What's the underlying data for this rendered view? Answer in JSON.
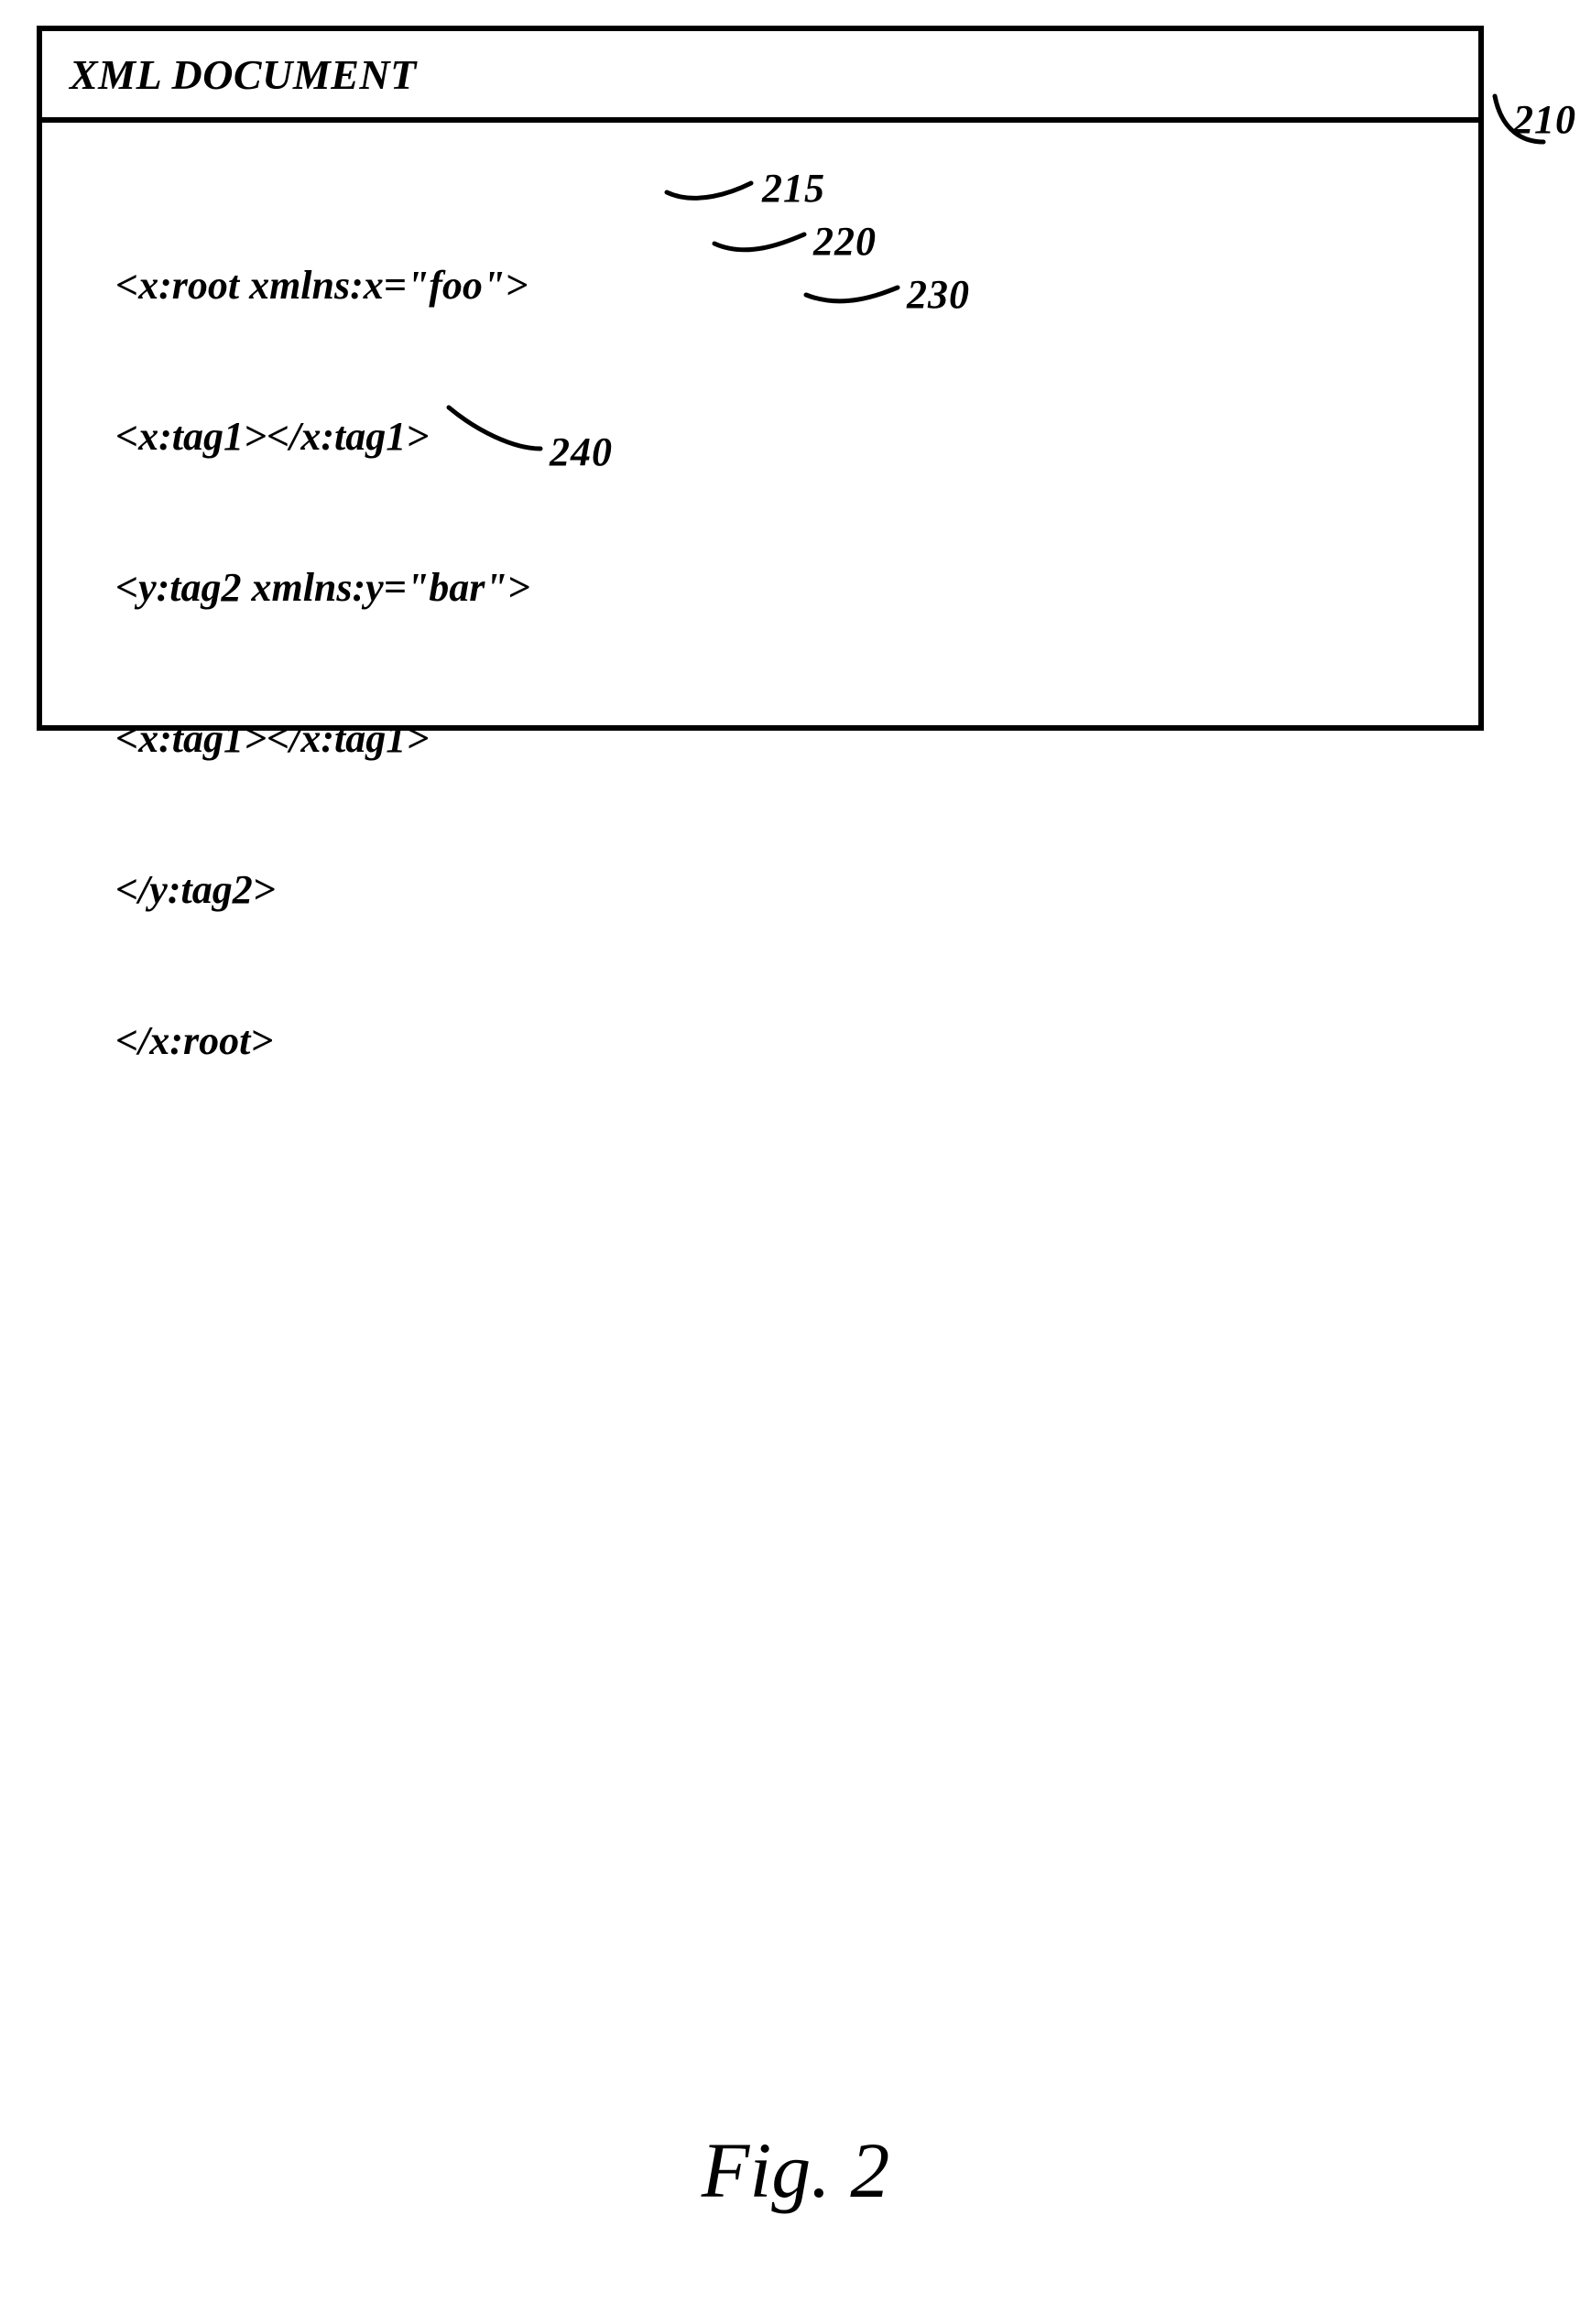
{
  "frame": {
    "title": "XML DOCUMENT",
    "lines": [
      {
        "indent": 0,
        "text": "<x:root xmlns:x=\"foo\">",
        "ref": "215"
      },
      {
        "indent": 2,
        "text": "<x:tag1></x:tag1>",
        "ref": "220"
      },
      {
        "indent": 2,
        "text": "<y:tag2 xmlns:y=\"bar\">",
        "ref": "230"
      },
      {
        "indent": 4,
        "text": "<x:tag1></x:tag1>",
        "ref": null
      },
      {
        "indent": 2,
        "text": "</y:tag2>",
        "ref": "240"
      },
      {
        "indent": 0,
        "text": "</x:root>",
        "ref": null
      }
    ],
    "outer_ref": "210"
  },
  "caption": "Fig. 2"
}
